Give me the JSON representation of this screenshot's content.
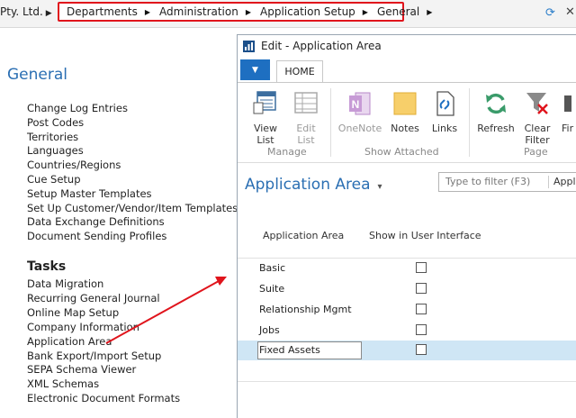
{
  "topbar": {
    "company": "Pty. Ltd.",
    "breadcrumb": [
      "Departments",
      "Administration",
      "Application Setup",
      "General"
    ]
  },
  "left": {
    "heading": "General",
    "general_items": [
      "Change Log Entries",
      "Post Codes",
      "Territories",
      "Languages",
      "Countries/Regions",
      "Cue Setup",
      "Setup Master Templates",
      "Set Up Customer/Vendor/Item Templates",
      "Data Exchange Definitions",
      "Document Sending Profiles"
    ],
    "tasks_heading": "Tasks",
    "task_items": [
      "Data Migration",
      "Recurring General Journal",
      "Online Map Setup",
      "Company Information",
      "Application Area",
      "Bank Export/Import Setup",
      "SEPA Schema Viewer",
      "XML Schemas",
      "Electronic Document Formats"
    ]
  },
  "window": {
    "title": "Edit - Application Area",
    "tab": "HOME",
    "ribbon": {
      "view_list": "View\nList",
      "edit_list": "Edit\nList",
      "onenote": "OneNote",
      "notes": "Notes",
      "links": "Links",
      "refresh": "Refresh",
      "clear_filter": "Clear\nFilter",
      "find": "Fir",
      "groups": {
        "manage": "Manage",
        "show_attached": "Show Attached",
        "page": "Page"
      }
    },
    "page_title": "Application Area",
    "filter_placeholder": "Type to filter (F3)",
    "filter_field": "Appl",
    "columns": [
      "Application Area",
      "Show in User Interface"
    ],
    "rows": [
      {
        "name": "Basic",
        "checked": false
      },
      {
        "name": "Suite",
        "checked": false
      },
      {
        "name": "Relationship Mgmt",
        "checked": false
      },
      {
        "name": "Jobs",
        "checked": false
      },
      {
        "name": "Fixed Assets",
        "checked": false,
        "selected": true
      }
    ]
  },
  "colors": {
    "accent": "#2b6fb3",
    "highlight_box": "#e0141c",
    "selected_row": "#cfe6f5"
  }
}
